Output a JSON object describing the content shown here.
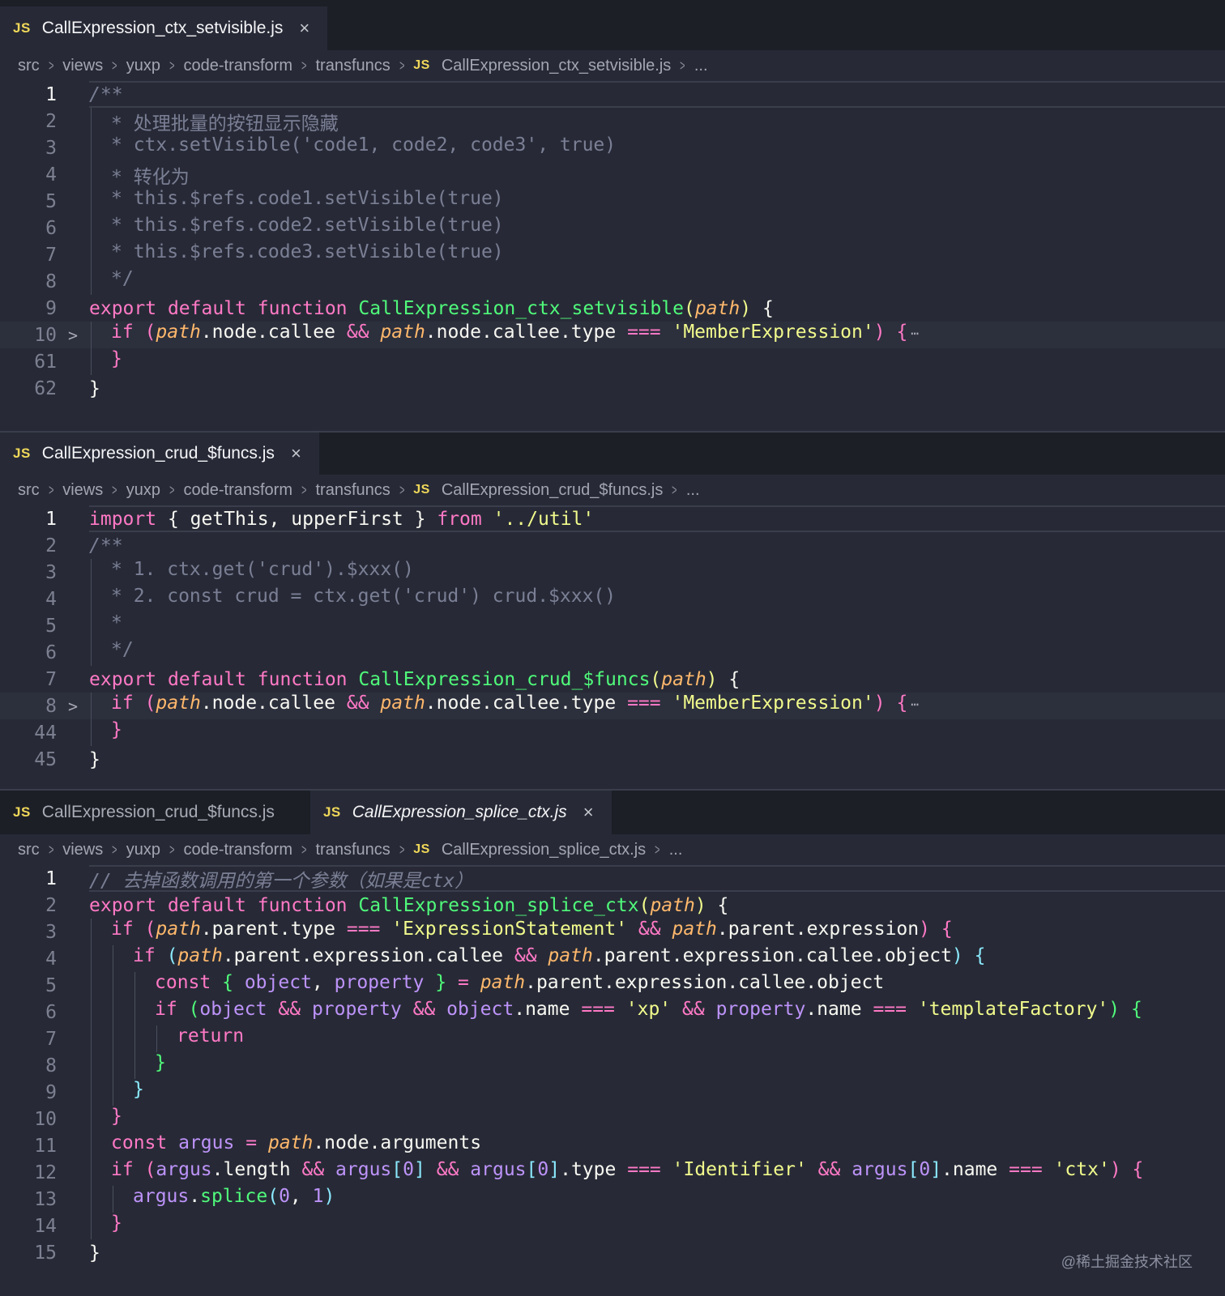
{
  "pane1": {
    "tab": {
      "icon": "JS",
      "label": "CallExpression_ctx_setvisible.js",
      "close": "×"
    },
    "breadcrumb": [
      "src",
      "views",
      "yuxp",
      "code-transform",
      "transfuncs",
      "CallExpression_ctx_setvisible.js",
      "..."
    ],
    "line_numbers": [
      "1",
      "2",
      "3",
      "4",
      "5",
      "6",
      "7",
      "8",
      "9",
      "10",
      "61",
      "62"
    ]
  },
  "pane2": {
    "tab": {
      "icon": "JS",
      "label": "CallExpression_crud_$funcs.js",
      "close": "×"
    },
    "breadcrumb": [
      "src",
      "views",
      "yuxp",
      "code-transform",
      "transfuncs",
      "CallExpression_crud_$funcs.js",
      "..."
    ],
    "line_numbers": [
      "1",
      "2",
      "3",
      "4",
      "5",
      "6",
      "7",
      "8",
      "44",
      "45"
    ]
  },
  "pane3": {
    "tabs": [
      {
        "icon": "JS",
        "label": "CallExpression_crud_$funcs.js"
      },
      {
        "icon": "JS",
        "label": "CallExpression_splice_ctx.js",
        "close": "×"
      }
    ],
    "breadcrumb": [
      "src",
      "views",
      "yuxp",
      "code-transform",
      "transfuncs",
      "CallExpression_splice_ctx.js",
      "..."
    ],
    "line_numbers": [
      "1",
      "2",
      "3",
      "4",
      "5",
      "6",
      "7",
      "8",
      "9",
      "10",
      "11",
      "12",
      "13",
      "14",
      "15"
    ]
  },
  "code": {
    "p1": {
      "l1": "/**",
      "l2": "* 处理批量的按钮显示隐藏",
      "l3": "* ctx.setVisible('code1, code2, code3', true)",
      "l4": "* 转化为",
      "l5": "* this.$refs.code1.setVisible(true)",
      "l6": "* this.$refs.code2.setVisible(true)",
      "l7": "* this.$refs.code3.setVisible(true)",
      "l8": "*/",
      "export": "export",
      "default": "default",
      "function": "function",
      "fname": "CallExpression_ctx_setvisible",
      "param": "path",
      "if": "if",
      "node_callee": ".node.callee",
      "and": "&&",
      "node_callee_type": ".node.callee.type",
      "eq": "===",
      "member": "'MemberExpression'",
      "ellipsis": "⋯"
    },
    "p2": {
      "import": "import",
      "imports": "getThis, upperFirst",
      "from": "from",
      "module": "'../util'",
      "l2": "/**",
      "l3": "* 1. ctx.get('crud').$xxx()",
      "l4": "* 2. const crud = ctx.get('crud') crud.$xxx()",
      "l5": "*",
      "l6": "*/",
      "fname": "CallExpression_crud_$funcs"
    },
    "p3": {
      "l1": "// 去掉函数调用的第一个参数（如果是ctx）",
      "fname": "CallExpression_splice_ctx",
      "parent_type": ".parent.type",
      "expr_stmt": "'ExpressionStatement'",
      "parent_expression": ".parent.expression",
      "parent_expr_callee": ".parent.expression.callee",
      "parent_expr_callee_object": ".parent.expression.callee.object",
      "const": "const",
      "object": "object",
      "property": "property",
      "assign": "=",
      "dot_name": ".name",
      "xp": "'xp'",
      "template_factory": "'templateFactory'",
      "return": "return",
      "argus": "argus",
      "node_arguments": ".node.arguments",
      "dot_length": ".length",
      "zero": "0",
      "one": "1",
      "dot_type": ".type",
      "identifier": "'Identifier'",
      "ctx": "'ctx'",
      "splice": "splice"
    }
  },
  "watermark": "@稀土掘金技术社区"
}
